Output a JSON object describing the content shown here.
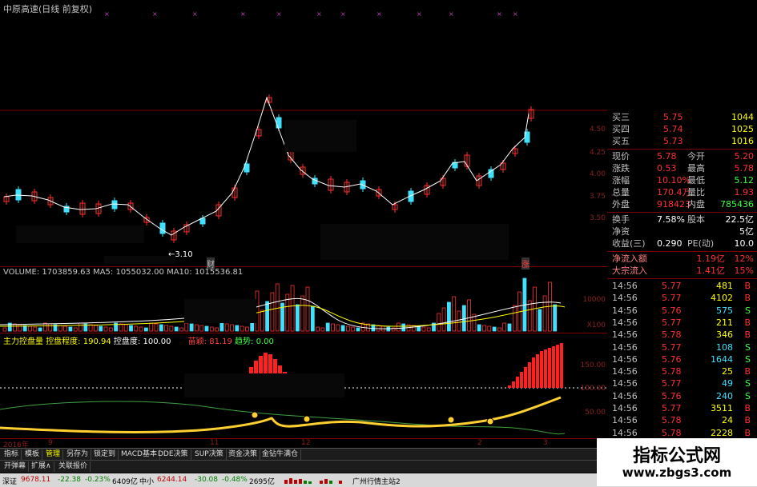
{
  "chart": {
    "title": "中原高速(日线 前复权)",
    "low_marker": "←3.10",
    "annot_cai": "财",
    "annot_zhang": "涨",
    "price_labels": [
      "4.50",
      "4.25",
      "4.00",
      "3.75",
      "3.50"
    ],
    "volume_header": {
      "label": "VOLUME: 1703859.63",
      "ma5": "MA5: 1055032.00",
      "ma10": "MA10: 1015536.81"
    },
    "volume_labels": [
      "10000",
      "X100"
    ],
    "indicator_header": {
      "name": "主力控盘量",
      "degree": "控盘程度: 190.94",
      "control": "控盘度: 100.00",
      "bei": "苗颖: 81.19",
      "dep": "趋势: 0.00"
    },
    "indicator_labels": [
      "150.00",
      "100.00",
      "50.00"
    ],
    "date_labels": [
      "2016年",
      "9",
      "11",
      "12",
      "2",
      "3"
    ]
  },
  "quote": {
    "bids": [
      {
        "label": "买三",
        "price": "5.75",
        "vol": "1044"
      },
      {
        "label": "买四",
        "price": "5.74",
        "vol": "1025"
      },
      {
        "label": "买五",
        "price": "5.73",
        "vol": "1016"
      }
    ],
    "stats": [
      {
        "l1": "现价",
        "v1": "5.78",
        "l2": "今开",
        "v2": "5.20"
      },
      {
        "l1": "涨跌",
        "v1": "0.53",
        "l2": "最高",
        "v2": "5.78"
      },
      {
        "l1": "涨幅",
        "v1": "10.10%",
        "l2": "最低",
        "v2": "5.12"
      },
      {
        "l1": "总量",
        "v1": "170.4万",
        "l2": "量比",
        "v2": "1.93"
      },
      {
        "l1": "外盘",
        "v1": "918423",
        "l2": "内盘",
        "v2": "785436"
      }
    ],
    "extra": [
      {
        "l1": "换手",
        "v1": "7.58%",
        "l2": "股本",
        "v2": "22.5亿"
      },
      {
        "l1": "净资",
        "v1": "",
        "l2": "",
        "v2": "5亿"
      },
      {
        "l1": "收益(三)",
        "v1": "0.290",
        "l2": "PE(动)",
        "v2": "10.0"
      }
    ],
    "flows": [
      {
        "label": "净流入额",
        "value": "1.19亿",
        "pct": "12%"
      },
      {
        "label": "大宗流入",
        "value": "1.41亿",
        "pct": "15%"
      }
    ],
    "ticks": [
      {
        "t": "14:56",
        "p": "5.77",
        "v": "481",
        "s": "B"
      },
      {
        "t": "14:56",
        "p": "5.77",
        "v": "4102",
        "s": "B"
      },
      {
        "t": "14:56",
        "p": "5.76",
        "v": "575",
        "s": "S"
      },
      {
        "t": "14:56",
        "p": "5.77",
        "v": "211",
        "s": "B"
      },
      {
        "t": "14:56",
        "p": "5.78",
        "v": "346",
        "s": "B"
      },
      {
        "t": "14:56",
        "p": "5.77",
        "v": "108",
        "s": "S"
      },
      {
        "t": "14:56",
        "p": "5.76",
        "v": "1644",
        "s": "S"
      },
      {
        "t": "14:56",
        "p": "5.78",
        "v": "25",
        "s": "B"
      },
      {
        "t": "14:56",
        "p": "5.77",
        "v": "49",
        "s": "S"
      },
      {
        "t": "14:56",
        "p": "5.76",
        "v": "240",
        "s": "S"
      },
      {
        "t": "14:56",
        "p": "5.77",
        "v": "3511",
        "s": "B"
      },
      {
        "t": "14:56",
        "p": "5.78",
        "v": "24",
        "s": "B"
      },
      {
        "t": "14:56",
        "p": "5.78",
        "v": "2228",
        "s": "B"
      }
    ]
  },
  "tabs": [
    "指标",
    "模板",
    "管理",
    "另存为",
    "锁定到",
    "MACD基本",
    "DDE决策",
    "SUP决策",
    "资金决策",
    "金钻牛满仓"
  ],
  "tabs2": [
    "开弹幕",
    "扩展∧",
    "关联报价"
  ],
  "status": {
    "sh_label": "深证",
    "sh_value": "9678.11",
    "sh_change": "-22.38",
    "sh_pct": "-0.23%",
    "sh_amount": "6409亿",
    "sz_label": "中小",
    "sz_value": "6244.14",
    "sz_change": "-30.08",
    "sz_pct": "-0.48%",
    "sz_amount": "2695亿",
    "server": "广州行情主站2"
  },
  "watermark": {
    "title": "指标公式网",
    "url": "www.zbgs3.com"
  },
  "colors": {
    "up": "#ff3030",
    "down": "#40e0ff",
    "ma": "#ffffff",
    "grid": "#800000",
    "accent": "#ffff00"
  }
}
